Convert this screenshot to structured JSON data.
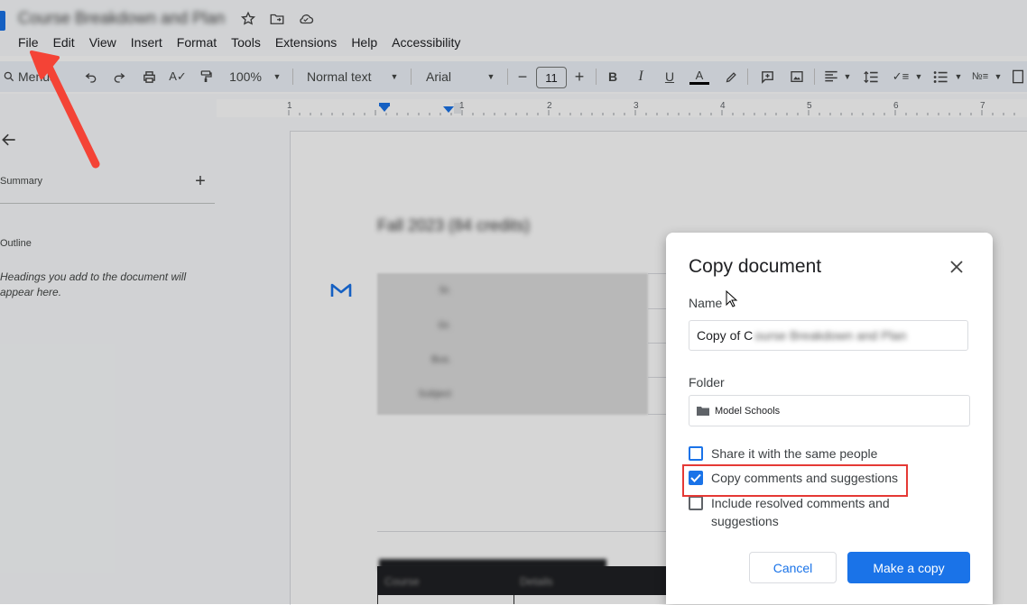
{
  "window": {
    "title_blurred": "Course Breakdown and Plan",
    "menu": [
      "File",
      "Edit",
      "View",
      "Insert",
      "Format",
      "Tools",
      "Extensions",
      "Help",
      "Accessibility"
    ]
  },
  "toolbar": {
    "search_label": "Menus",
    "zoom": "100%",
    "style": "Normal text",
    "font": "Arial",
    "font_size": "11"
  },
  "ruler": {
    "numbers": [
      "1",
      "1",
      "2",
      "3",
      "4",
      "5",
      "6",
      "7"
    ]
  },
  "left_panel": {
    "summary_label": "Summary",
    "outline_label": "Outline",
    "outline_hint": "Headings you add to the document will appear here."
  },
  "document": {
    "heading_blurred": "Fall 2023 (84 credits)",
    "table_labels_blurred": [
      "Sr.",
      "Gr.",
      "Bus.",
      "Subject"
    ],
    "dark_table_headers_blurred": [
      "Course",
      "Details"
    ]
  },
  "dialog": {
    "title": "Copy document",
    "name_label": "Name",
    "name_value_prefix": "Copy of C",
    "name_value_blurred": "ourse Breakdown and Plan",
    "folder_label": "Folder",
    "folder_value": "Model Schools",
    "option_share": "Share it with the same people",
    "option_copy_comments": "Copy comments and suggestions",
    "option_resolved_line1": "Include resolved comments and",
    "option_resolved_line2": "suggestions",
    "cancel_label": "Cancel",
    "make_copy_label": "Make a copy",
    "option_states": {
      "share": false,
      "copy_comments": true,
      "resolved": false
    }
  },
  "colors": {
    "accent": "#1a73e8",
    "highlight": "#e53935",
    "arrow": "#f44336"
  }
}
